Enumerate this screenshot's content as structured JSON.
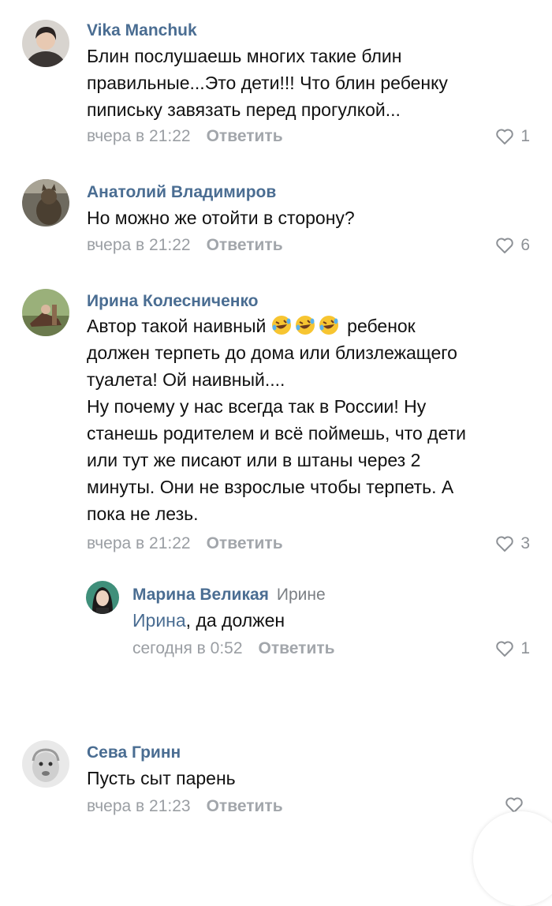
{
  "comments": [
    {
      "author": "Vika Manchuk",
      "text_lines": [
        "Блин  послушаешь многих такие блин",
        "правильные...Это дети!!! Что блин ребенку",
        "пипиську завязать перед прогулкой..."
      ],
      "time": "вчера в 21:22",
      "reply_label": "Ответить",
      "likes": "1"
    },
    {
      "author": "Анатолий Владимиров",
      "text_lines": [
        "Но можно же отойти в сторону?"
      ],
      "time": "вчера в 21:22",
      "reply_label": "Ответить",
      "likes": "6"
    },
    {
      "author": "Ирина Колесниченко",
      "text_line1_before": "Автор такой наивный",
      "text_line1_after": "ребенок",
      "emoji_name": "rolling-on-the-floor-laughing",
      "text_lines": [
        "должен терпеть до дома или близлежащего",
        "туалета! Ой наивный....",
        "Ну почему у нас всегда так в России! Ну",
        "станешь родителем и всё поймешь, что дети",
        "или тут же писают или в штаны через 2",
        "минуты. Они не взрослые чтобы терпеть. А",
        "пока не лезь."
      ],
      "time": "вчера в 21:22",
      "reply_label": "Ответить",
      "likes": "3"
    },
    {
      "author": "Марина Великая",
      "reply_to": "Ирине",
      "mention": "Ирина",
      "text_rest": ", да должен",
      "time": "сегодня в 0:52",
      "reply_label": "Ответить",
      "likes": "1"
    },
    {
      "author": "Сева Гринн",
      "text_lines": [
        "Пусть сыт парень"
      ],
      "time": "вчера в 21:23",
      "reply_label": "Ответить",
      "likes": ""
    }
  ],
  "icons": {
    "like": "heart-outline-icon"
  },
  "colors": {
    "author": "#4a6d92",
    "meta": "#9a9ea3",
    "like": "#8d9196"
  }
}
